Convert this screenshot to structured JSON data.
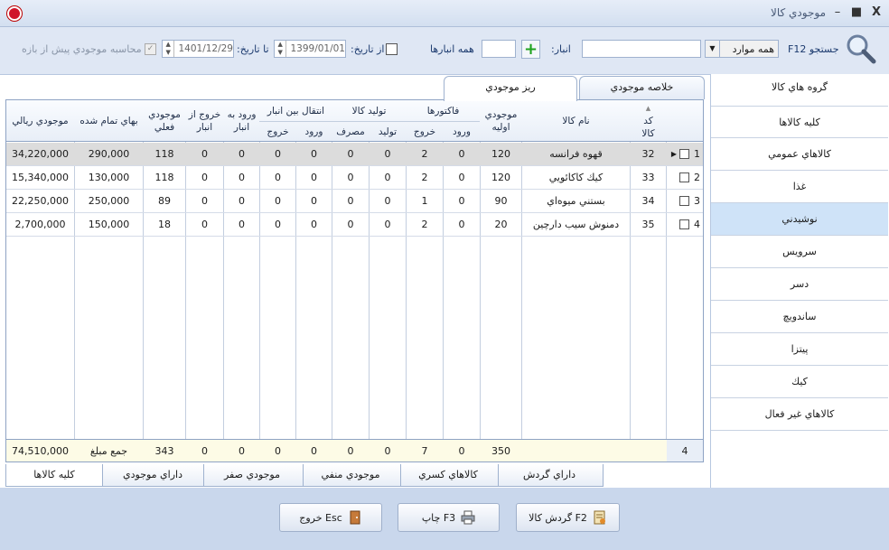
{
  "window": {
    "title": "موجودي كالا",
    "close": "X",
    "maximize": "▫",
    "minimize": "–"
  },
  "toolbar": {
    "search_label": "جستجو F12",
    "filter_value": "همه موارد",
    "search_value": "",
    "warehouse_label": "انبار:",
    "warehouse_value": "",
    "all_warehouses_label": "همه انبارها",
    "from_date_label": "از تاريخ:",
    "from_date": "1399/01/01",
    "to_date_label": "تا تاريخ:",
    "to_date": "1401/12/29",
    "pre_range_label": "محاسبه موجودي پيش از بازه"
  },
  "tabs": {
    "summary": "خلاصه موجودي",
    "detail": "ريز موجودي"
  },
  "groups": {
    "title": "گروه هاي كالا",
    "items": [
      "كليه كالاها",
      "كالاهاي عمومي",
      "غذا",
      "نوشيدني",
      "سرويس",
      "دسر",
      "ساندويچ",
      "پيتزا",
      "كيك",
      "كالاهاي غير فعال"
    ]
  },
  "grid": {
    "headers": {
      "code": "كد كالا",
      "name": "نام كالا",
      "initial": "موجودي اوليه",
      "invoices": "فاكتورها",
      "production": "توليد كالا",
      "transfer": "انتقال بين انبار",
      "in": "ورود",
      "out": "خروج",
      "produce": "توليد",
      "consume": "مصرف",
      "wh_in": "ورود به انبار",
      "wh_out": "خروج از انبار",
      "current": "موجودي فعلي",
      "unit_cost": "بهاي تمام شده",
      "value": "موجودي ريالي"
    },
    "rows": [
      {
        "n": "1",
        "code": "32",
        "name": "قهوه فرانسه",
        "initial": "120",
        "inv_in": "0",
        "inv_out": "2",
        "prod": "0",
        "cons": "0",
        "tr_in": "0",
        "tr_out": "0",
        "wh_in": "0",
        "wh_out": "0",
        "current": "118",
        "cost": "290,000",
        "value": "34,220,000"
      },
      {
        "n": "2",
        "code": "33",
        "name": "كيك كاكائويي",
        "initial": "120",
        "inv_in": "0",
        "inv_out": "2",
        "prod": "0",
        "cons": "0",
        "tr_in": "0",
        "tr_out": "0",
        "wh_in": "0",
        "wh_out": "0",
        "current": "118",
        "cost": "130,000",
        "value": "15,340,000"
      },
      {
        "n": "3",
        "code": "34",
        "name": "بستني ميوه‌اي",
        "initial": "90",
        "inv_in": "0",
        "inv_out": "1",
        "prod": "0",
        "cons": "0",
        "tr_in": "0",
        "tr_out": "0",
        "wh_in": "0",
        "wh_out": "0",
        "current": "89",
        "cost": "250,000",
        "value": "22,250,000"
      },
      {
        "n": "4",
        "code": "35",
        "name": "دمنوش سيب دارچين",
        "initial": "20",
        "inv_in": "0",
        "inv_out": "2",
        "prod": "0",
        "cons": "0",
        "tr_in": "0",
        "tr_out": "0",
        "wh_in": "0",
        "wh_out": "0",
        "current": "18",
        "cost": "150,000",
        "value": "2,700,000"
      }
    ],
    "footer": {
      "count": "4",
      "initial": "350",
      "inv_in": "0",
      "inv_out": "7",
      "prod": "0",
      "cons": "0",
      "tr_in": "0",
      "tr_out": "0",
      "wh_in": "0",
      "wh_out": "0",
      "current": "343",
      "cost_label": "جمع مبلغ",
      "value": "74,510,000"
    }
  },
  "bottom_tabs": [
    "داراي گردش",
    "كالاهاي كسري",
    "موجودي منفي",
    "موجودي صفر",
    "داراي موجودي",
    "كليه كالاها"
  ],
  "buttons": {
    "turnover": "گردش كالا F2",
    "print": "چاپ F3",
    "exit": "خروج Esc"
  },
  "icons": [
    "magnifier-icon",
    "plus-icon",
    "printer-icon",
    "door-icon",
    "ledger-icon"
  ],
  "colors": {
    "accent": "#1d4c9a",
    "selected_group": "#cfe3f8",
    "footer": "#fdfbe6",
    "close_red": "#d0142a"
  }
}
